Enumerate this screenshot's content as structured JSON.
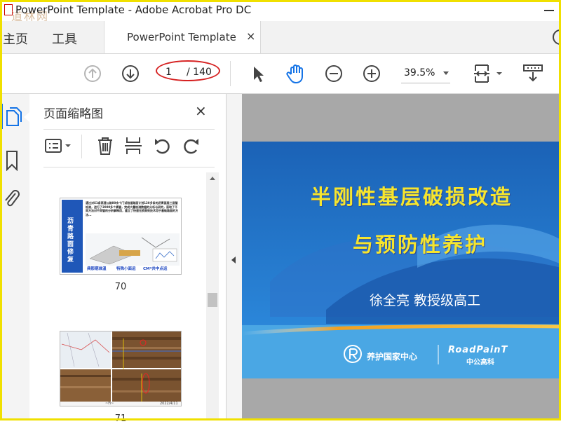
{
  "window": {
    "title": "PowerPoint Template - Adobe Acrobat Pro DC",
    "watermark": "道林网"
  },
  "nav": {
    "home": "主页",
    "tools": "工具",
    "tab_label": "PowerPoint Template",
    "tab_close": "×"
  },
  "toolbar": {
    "current_page": "1",
    "total_pages": "/ 140",
    "zoom": "39.5%",
    "icons": [
      "prev-page-icon",
      "next-page-icon",
      "select-arrow-icon",
      "hand-icon",
      "zoom-out-icon",
      "zoom-in-icon",
      "page-fit-icon",
      "scroll-mode-icon"
    ]
  },
  "panel": {
    "title": "页面缩略图",
    "close": "×",
    "thumbnails": [
      {
        "page_label": "70",
        "side_text": "沥青路面修复",
        "body_text": "通过对S1条高速公路80余个门试验道路面计划120多条的沥青面层三层管检测，进行了2000多个桶管，完成大量检测数据的分析与研究，获取了不同方法对不同管的分析解释用，建立了快速无损高效技术用于基础路面的方法...",
        "captions": [
          "典那期准温",
          "特殊小面运",
          "CM*共中点运"
        ]
      },
      {
        "page_label": "71",
        "date_text": "2022/4/11",
        "footer_left": "~Fi~"
      }
    ]
  },
  "slide": {
    "title_line1": "半刚性基层破损改造",
    "title_line2": "与预防性养护",
    "author": "徐全亮 教授级高工",
    "logo_left": "养护国家中心",
    "logo_right_top": "RoadPainT",
    "logo_right_bottom": "中公高科",
    "colors": {
      "background_top": "#1b62b6",
      "title": "#f6e52d",
      "stripe": "#f2a020"
    }
  }
}
